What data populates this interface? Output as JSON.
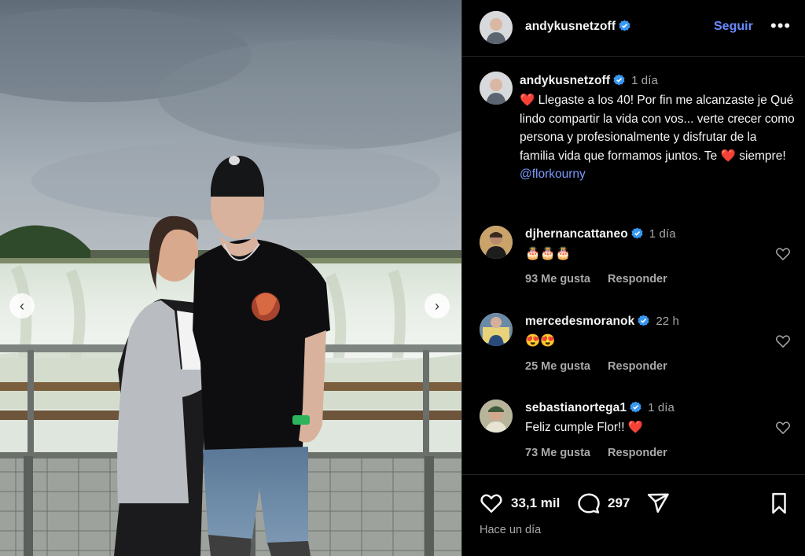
{
  "post": {
    "author": "andykusnetzoff",
    "follow_label": "Seguir",
    "more_label": "•••"
  },
  "caption": {
    "author": "andykusnetzoff",
    "time": "1 día",
    "text_part1": "❤️ Llegaste a los 40! Por fin me alcanzaste je Qué lindo compartir la vida con vos... verte crecer como persona y profesionalmente y disfrutar de la familia vida que formamos juntos. Te ❤️ siempre! ",
    "mention": "@florkourny"
  },
  "comments": [
    {
      "user": "djhernancattaneo",
      "time": "1 día",
      "text": "🎂🎂🎂",
      "likes": "93 Me gusta",
      "reply": "Responder"
    },
    {
      "user": "mercedesmoranok",
      "time": "22 h",
      "text": "😍😍",
      "likes": "25 Me gusta",
      "reply": "Responder"
    },
    {
      "user": "sebastianortega1",
      "time": "1 día",
      "text": "Feliz cumple Flor!! ❤️",
      "likes": "73 Me gusta",
      "reply": "Responder"
    }
  ],
  "actions": {
    "likes": "33,1 mil",
    "comments": "297",
    "date": "Hace un día"
  },
  "carousel": {
    "prev_icon": "chevron-left-icon",
    "next_icon": "chevron-right-icon",
    "prev_glyph": "‹",
    "next_glyph": "›"
  },
  "colors": {
    "background": "#000000",
    "link": "#6b8cff",
    "verified": "#3897f0",
    "muted": "#a8a8a8"
  }
}
